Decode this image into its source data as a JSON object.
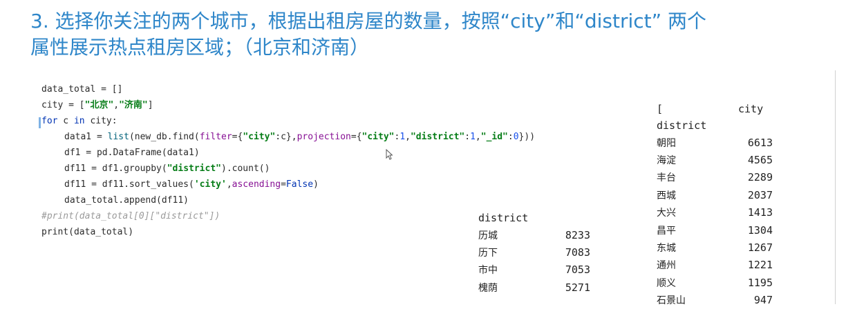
{
  "heading": {
    "line1": "3. 选择你关注的两个城市，根据出租房屋的数量，按照“city”和“district” 两个",
    "line2": "属性展示热点租房区域；（北京和济南）"
  },
  "code": {
    "l1": "data_total = []",
    "l2_a": "city = [",
    "l2_s1": "\"北京\"",
    "l2_b": ",",
    "l2_s2": "\"济南\"",
    "l2_c": "]",
    "l3_kw1": "for",
    "l3_a": " c ",
    "l3_kw2": "in",
    "l3_b": " city:",
    "l4_a": "data1 = ",
    "l4_fn": "list",
    "l4_b": "(new_db.find(",
    "l4_p1": "filter",
    "l4_c": "={",
    "l4_s1": "\"city\"",
    "l4_d": ":c},",
    "l4_p2": "projection",
    "l4_e": "={",
    "l4_s2": "\"city\"",
    "l4_f": ":",
    "l4_n1": "1",
    "l4_g": ",",
    "l4_s3": "\"district\"",
    "l4_h": ":",
    "l4_n2": "1",
    "l4_i": ",",
    "l4_s4": "\"_id\"",
    "l4_j": ":",
    "l4_n3": "0",
    "l4_k": "}))",
    "l5": "df1 = pd.DataFrame(data1)",
    "l6_a": "df11 = df1.groupby(",
    "l6_s": "\"district\"",
    "l6_b": ").count()",
    "l7_a": "df11 = df11.sort_values(",
    "l7_s": "'city'",
    "l7_b": ",",
    "l7_p": "ascending",
    "l7_c": "=",
    "l7_kw": "False",
    "l7_d": ")",
    "l8": "data_total.append(df11)",
    "l9": "#print(data_total[0][\"district\"])",
    "l10": "print(data_total)"
  },
  "output_jinan": {
    "header": "district",
    "rows": [
      {
        "name": "历城",
        "value": "8233"
      },
      {
        "name": "历下",
        "value": "7083"
      },
      {
        "name": "市中",
        "value": "7053"
      },
      {
        "name": "槐荫",
        "value": "5271"
      }
    ]
  },
  "output_beijing": {
    "bracket": "[",
    "col": "city",
    "index_name": "district",
    "rows": [
      {
        "name": "朝阳",
        "value": "6613"
      },
      {
        "name": "海淀",
        "value": "4565"
      },
      {
        "name": "丰台",
        "value": "2289"
      },
      {
        "name": "西城",
        "value": "2037"
      },
      {
        "name": "大兴",
        "value": "1413"
      },
      {
        "name": "昌平",
        "value": "1304"
      },
      {
        "name": "东城",
        "value": "1267"
      },
      {
        "name": "通州",
        "value": "1221"
      },
      {
        "name": "顺义",
        "value": "1195"
      },
      {
        "name": "石景山",
        "value": "947"
      }
    ]
  }
}
